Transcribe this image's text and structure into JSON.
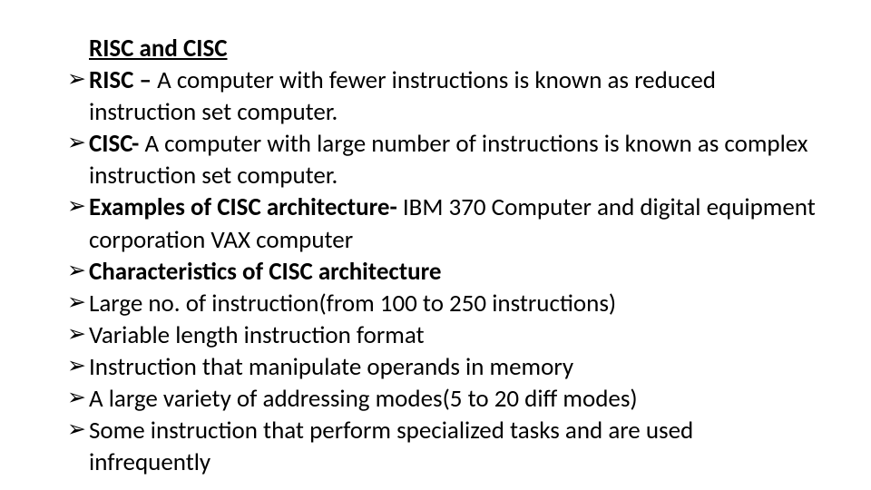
{
  "title": "RISC and CISC",
  "bullets": [
    {
      "bold": "RISC – ",
      "text": "A computer with fewer instructions is known as reduced instruction set computer."
    },
    {
      "bold": "CISC- ",
      "text": "A computer with large number of instructions is known as complex instruction set computer."
    },
    {
      "bold": "Examples of CISC architecture- ",
      "text": "IBM 370 Computer and digital equipment corporation VAX computer"
    },
    {
      "bold": "Characteristics of CISC architecture",
      "text": ""
    },
    {
      "bold": "",
      "text": "Large no. of instruction(from 100 to 250 instructions)"
    },
    {
      "bold": "",
      "text": "Variable length instruction format"
    },
    {
      "bold": "",
      "text": "Instruction that manipulate operands in memory"
    },
    {
      "bold": "",
      "text": "A large variety of addressing modes(5 to 20 diff modes)"
    },
    {
      "bold": "",
      "text": "Some instruction that perform specialized tasks and are used infrequently"
    }
  ],
  "bullet_glyph": "➢"
}
